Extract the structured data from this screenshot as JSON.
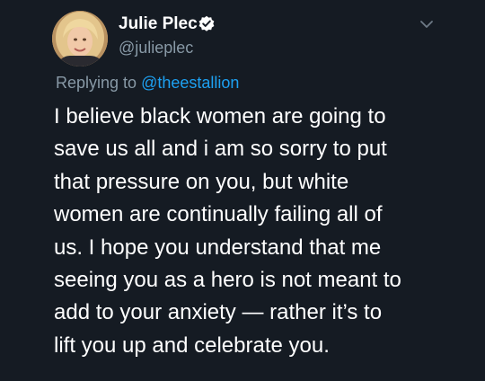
{
  "tweet": {
    "display_name": "Julie Plec",
    "handle": "@julieplec",
    "replying_to_prefix": "Replying to ",
    "replying_to_handle": "@theestallion",
    "text": "I believe black women are going to\nsave us all and i am so sorry to put\nthat pressure on you, but white\nwomen are continually failing all of\nus. I hope you understand that me\nseeing you as a hero is not meant to\nadd to your anxiety — rather it’s to\nlift you up and celebrate you."
  },
  "icons": {
    "verified": "verified-badge-icon",
    "more": "chevron-down-icon"
  },
  "colors": {
    "background": "#151b23",
    "text": "#ffffff",
    "secondary": "#8899a6",
    "accent": "#1da1f2"
  }
}
